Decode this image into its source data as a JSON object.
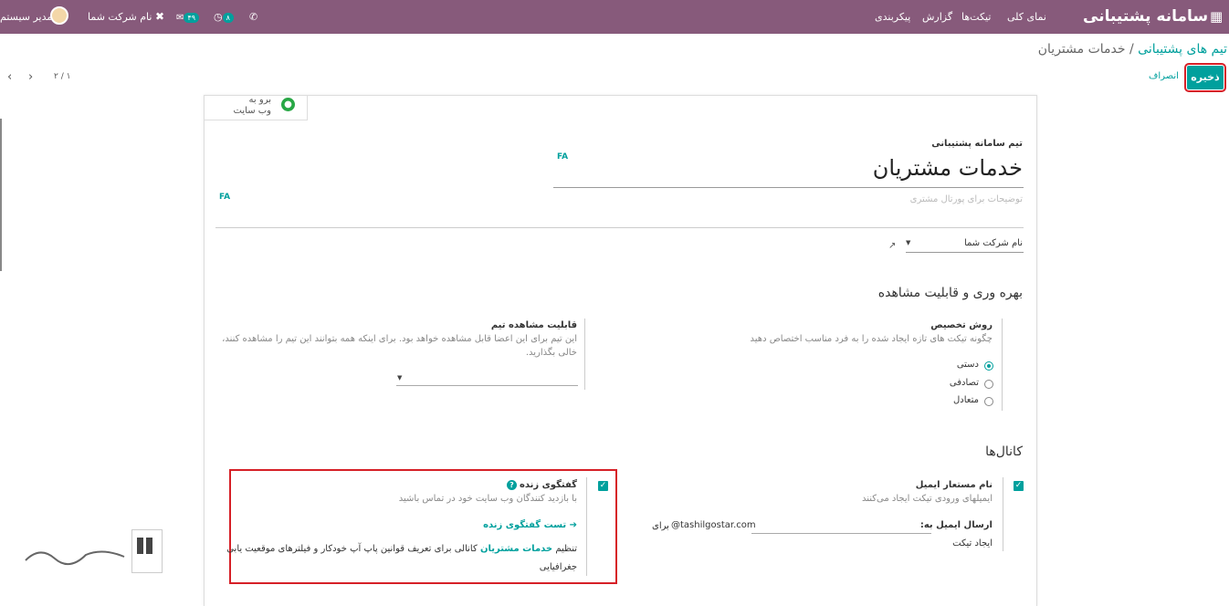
{
  "topbar": {
    "app_title": "سامانه پشتیبانی",
    "menu": [
      "نمای کلی",
      "تیکت‌ها",
      "گزارش",
      "پیکربندی"
    ],
    "user": "مدیر سیستم",
    "company": "نام شرکت شما",
    "activity_count": "۸",
    "message_count": "۴۹"
  },
  "breadcrumb": {
    "parent": "تیم های پشتیبانی",
    "current": "خدمات مشتریان"
  },
  "actions": {
    "save": "ذخیره",
    "discard": "انصراف"
  },
  "pager": "۲ / ۱",
  "website_button": {
    "line1": "برو به",
    "line2": "وب سایت"
  },
  "form": {
    "name_label": "تیم سامانه پشتیبانی",
    "name": "خدمات مشتریان",
    "lang_tag": "FA",
    "description_placeholder": "توضیحات برای پورتال مشتری",
    "company": "نام شرکت شما",
    "section_visibility": "بهره وری و قابلیت مشاهده",
    "assign_method": {
      "label": "روش تخصیص",
      "help": "چگونه تیکت های تازه ایجاد شده را به فرد مناسب اختصاص دهید",
      "options": [
        {
          "label": "دستی",
          "selected": true
        },
        {
          "label": "تصادفی",
          "selected": false
        },
        {
          "label": "متعادل",
          "selected": false
        }
      ]
    },
    "visibility": {
      "label": "قابلیت مشاهده تیم",
      "help1": "این تیم برای این اعضا قابل مشاهده خواهد بود. برای اینکه همه بتوانند این تیم را مشاهده کنند،",
      "help2": "خالی بگذارید."
    },
    "section_channels": "کانال‌ها",
    "email_alias": {
      "label": "نام مستعار ایمیل",
      "help": "ایمیلهای ورودی تیکت ایجاد می‌کنند",
      "send_label": "ارسال ایمیل به:",
      "domain": "@tashilgostar.com",
      "for_label": "برای",
      "create_ticket": "ایجاد تیکت",
      "checked": true
    },
    "live_chat": {
      "label": "گفتگوی زنده",
      "help": "با بازدید کنندگان وب سایت خود در تماس باشید",
      "test_link": "تست گفتگوی زنده",
      "config_prefix": "تنظیم",
      "config_link": "خدمات مشتریان",
      "config_suffix": "کانالی برای تعریف قوانین پاپ آپ خودکار و فیلترهای موقعیت یابی",
      "config_line2": "جغرافیایی",
      "checked": true
    }
  },
  "colors": {
    "purple": "#875a7b",
    "teal": "#00a09d",
    "highlight": "#d62027"
  }
}
